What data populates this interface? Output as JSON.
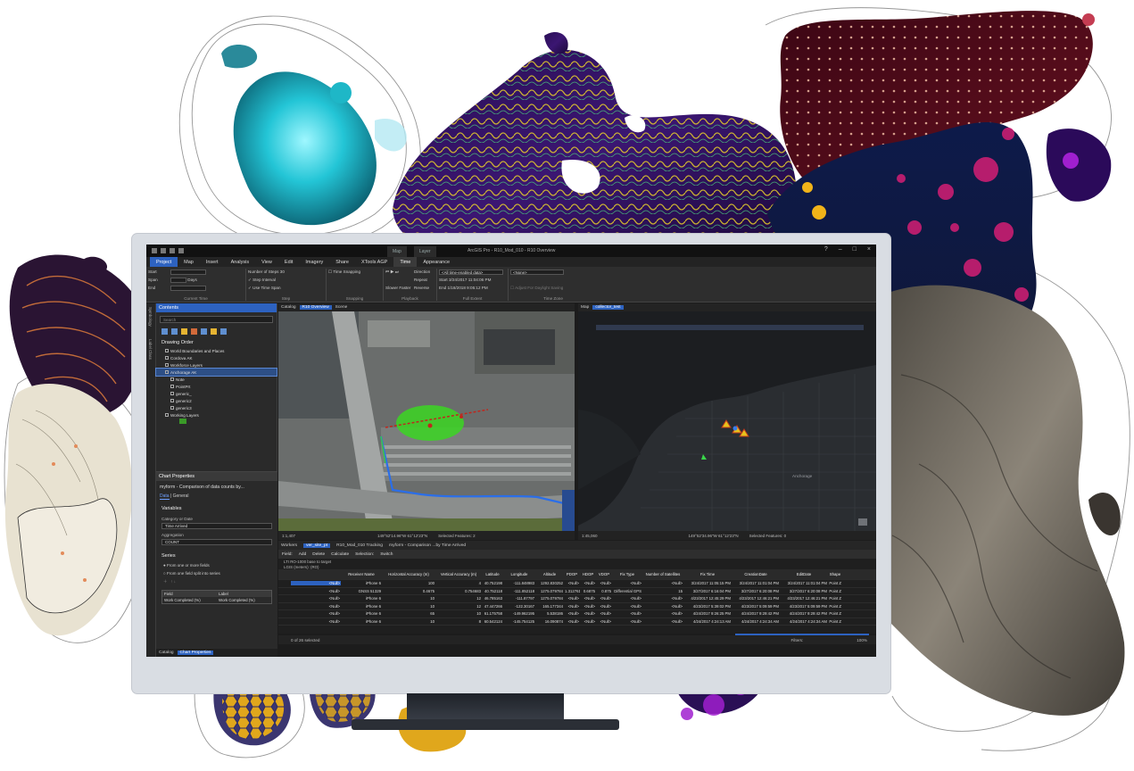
{
  "title": "ArcGIS Pro - R10_Mod_010 - R10 Overview",
  "context_tabs": [
    "Map",
    "Layer"
  ],
  "ribbon_tabs": [
    "Project",
    "Map",
    "Insert",
    "Analysis",
    "View",
    "Edit",
    "Imagery",
    "Share",
    "XTools AGP",
    "Time",
    "Appearance"
  ],
  "ribbon": {
    "current_time": {
      "start": "Start",
      "span": "Span",
      "end": "End",
      "span_unit": "Days",
      "caption": "Current Time"
    },
    "step": {
      "number_of_steps": "Number of Steps",
      "steps_value": "30",
      "step_interval": "Step Interval",
      "use_time_span": "Use Time Span",
      "caption": "Step"
    },
    "snapping": {
      "time_snapping": "Time Snapping",
      "caption": "Snapping"
    },
    "playback": {
      "slower": "Slower",
      "faster": "Faster",
      "direction": "Direction",
      "repeat": "Repeat",
      "reverse": "Reverse",
      "caption": "Playback"
    },
    "full_extent": {
      "dropdown": "<All time-enabled data>",
      "start_label": "Start",
      "start_value": "3/24/2017 11:04:06 PM",
      "end_label": "End",
      "end_value": "1/18/2018 9:05:12 PM",
      "caption": "Full Extent"
    },
    "time_zone": {
      "dropdown": "<None>",
      "adjust_dst": "Adjust For Daylight Saving",
      "caption": "Time Zone"
    }
  },
  "side_tabs": [
    "Symbology",
    "Label Class"
  ],
  "contents": {
    "title": "Contents",
    "search_placeholder": "Search",
    "drawing_order": "Drawing Order",
    "layers": [
      {
        "label": "World Boundaries and Places",
        "indent": 1
      },
      {
        "label": "Cordova AK",
        "indent": 1
      },
      {
        "label": "Workforce Layers",
        "indent": 1
      },
      {
        "label": "Anchorage AK",
        "indent": 1,
        "selected": true
      },
      {
        "label": "Note",
        "indent": 2
      },
      {
        "label": "PointPrt",
        "indent": 2
      },
      {
        "label": "generic_",
        "indent": 2
      },
      {
        "label": "generic2",
        "indent": 2
      },
      {
        "label": "generic3",
        "indent": 2
      },
      {
        "label": "Working Layers",
        "indent": 1
      }
    ]
  },
  "chart_properties": {
    "title": "Chart Properties",
    "subtitle": "myform - Comparison of data counts by...",
    "tabs": [
      "Data",
      "General"
    ],
    "variables": "Variables",
    "category_label": "Category or Date",
    "category_value": "Time Arrived",
    "aggregation_label": "Aggregation",
    "aggregation_value": "COUNT",
    "series": "Series",
    "radio1": "From one or more fields",
    "radio2": "From one field split into series",
    "grid_headers": [
      "Field",
      "Label"
    ],
    "grid_row": [
      "Work Completed (%)",
      "Work Completed (%)"
    ]
  },
  "bottom_tabs": [
    "Catalog",
    "Chart Properties"
  ],
  "pane_tabs_left": [
    "Catalog",
    "R10 Overview",
    "Scene"
  ],
  "pane_tabs_right": [
    "Map",
    "collector_test"
  ],
  "map_right_label": "Anchorage",
  "status_left": {
    "scale": "1:1,407",
    "coords": "149°52'14.96\"W 61°12'23\"N",
    "selected": "Selected Features: 2"
  },
  "status_right": {
    "scale": "1:45,060",
    "coords": "149°52'34.96\"W 61°12'23\"N",
    "selected": "Selected Features: 0"
  },
  "table_tabs": [
    "Workers",
    "ver_site_pt",
    "R10_Mod_010 Tracking",
    "myform - Comparison ...by Time Arrived"
  ],
  "table_toolbar": [
    "Field:",
    "Add",
    "Delete",
    "Calculate",
    "Selection:",
    "Switch"
  ],
  "table_note": "LTI RO-1000 base to target",
  "table_group": "LGIS (meters): (RO)",
  "table_columns": [
    "Receiver Name",
    "Horizontal Accuracy (m)",
    "Vertical Accuracy (m)",
    "Latitude",
    "Longitude",
    "Altitude",
    "PDOP",
    "HDOP",
    "VDOP",
    "Fix Type",
    "Number of Satellites",
    "Fix Time",
    "CreationDate",
    "EditDate",
    "Shape"
  ],
  "table_rows": [
    [
      "<Null>",
      "iPhone 6",
      "100",
      "4",
      "40.752198",
      "-111.848983",
      "1292.830252",
      "<Null>",
      "<Null>",
      "<Null>",
      "<Null>",
      "<Null>",
      "3/24/2017 11:05:15 PM",
      "3/24/2017 11:01:04 PM",
      "3/24/2017 11:01:04 PM",
      "Point Z"
    ],
    [
      "<Null>",
      "GNSS 51329",
      "0.4675",
      "0.754683",
      "40.752118",
      "-111.852118",
      "1275.079784",
      "1.312761",
      "0.6875",
      "0.875",
      "Differential GPS",
      "15",
      "3/27/2017 6:16:04 PM",
      "3/27/2017 6:20:08 PM",
      "3/27/2017 6:20:08 PM",
      "Point Z"
    ],
    [
      "<Null>",
      "iPhone 6",
      "10",
      "12",
      "46.785163",
      "-111.87797",
      "1275.079784",
      "<Null>",
      "<Null>",
      "<Null>",
      "<Null>",
      "<Null>",
      "4/23/2017 12:45:29 PM",
      "4/23/2017 12:46:21 PM",
      "4/23/2017 12:46:21 PM",
      "Point Z"
    ],
    [
      "<Null>",
      "iPhone 6",
      "10",
      "12",
      "47.447266",
      "-122.30167",
      "165.177344",
      "<Null>",
      "<Null>",
      "<Null>",
      "<Null>",
      "<Null>",
      "4/23/2017 5:39:02 PM",
      "4/23/2017 5:09:59 PM",
      "4/23/2017 5:09:59 PM",
      "Point Z"
    ],
    [
      "<Null>",
      "iPhone 6",
      "65",
      "10",
      "61.175758",
      "-149.962195",
      "5.538186",
      "<Null>",
      "<Null>",
      "<Null>",
      "<Null>",
      "<Null>",
      "4/24/2017 9:26:25 PM",
      "4/24/2017 9:29:42 PM",
      "4/24/2017 9:29:42 PM",
      "Point Z"
    ],
    [
      "<Null>",
      "iPhone 6",
      "10",
      "8",
      "60.542124",
      "-145.754125",
      "16.090874",
      "<Null>",
      "<Null>",
      "<Null>",
      "<Null>",
      "<Null>",
      "4/24/2017 4:24:13 AM",
      "4/24/2017 4:24:34 AM",
      "4/24/2017 4:24:34 AM",
      "Point Z"
    ]
  ],
  "table_status": "0 of 26 selected",
  "table_filters": "Filters:",
  "zoom": "100%",
  "colors": {
    "accent": "#2d62c0",
    "screen": "#1c1c1c",
    "panel": "#2a2a2a",
    "bezel": "#d9dde3"
  }
}
